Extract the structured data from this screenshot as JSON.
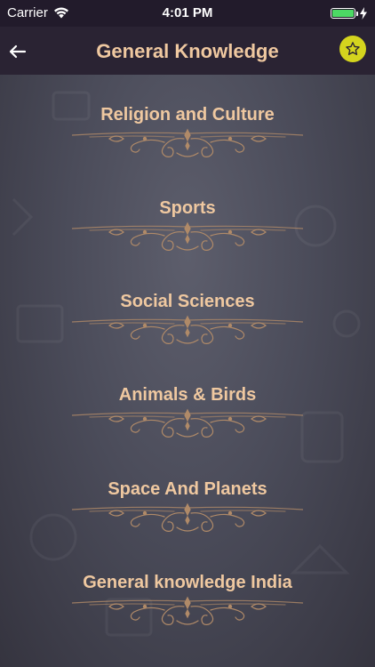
{
  "status": {
    "carrier": "Carrier",
    "time": "4:01 PM",
    "battery_level": 1.0,
    "icons": [
      "wifi-icon",
      "battery-icon",
      "charging-icon"
    ]
  },
  "header": {
    "title": "General Knowledge",
    "back_icon": "arrow-left-icon",
    "favorite_icon": "star-icon"
  },
  "colors": {
    "accent": "#efc8a0",
    "nav_bg": "#2a2333",
    "favorite_bg": "#d4d41e",
    "ornament": "#b08a68"
  },
  "categories": [
    {
      "label": "Religion and Culture"
    },
    {
      "label": "Sports"
    },
    {
      "label": "Social Sciences"
    },
    {
      "label": "Animals & Birds"
    },
    {
      "label": "Space And Planets"
    },
    {
      "label": "General knowledge India"
    }
  ]
}
